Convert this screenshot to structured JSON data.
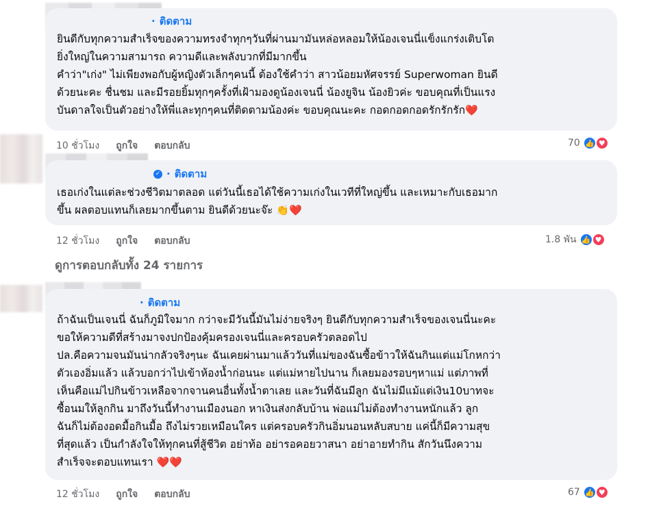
{
  "comments": [
    {
      "follow_label": "ติดตาม",
      "text": "ยินดีกับทุกความสำเร็จของความทรงจำทุกๆวันที่ผ่านมามันหล่อหลอมให้น้องเจนนี่แข็งแกร่งเติบโต\nยิ่งใหญ่ในความสามารถ ความดีและพลังบวกที่มีมากขึ้น\nคำว่า\"เก่ง\" ไม่เพียงพอกับผู้หญิงตัวเล็กๆคนนี้ ต้องใช้คำว่า สาวน้อยมหัศจรรย์ Superwoman ยินดี\nด้วยนะคะ ชื่นชม และมีรอยยิ้มทุกๆครั้งที่เฝ้ามองดูน้องเจนนี่ น้องยูจิน น้องยิวค่ะ ขอบคุณที่เป็นแรง\nบันดาลใจเป็นตัวอย่างให้พี่และทุกๆคนที่ติดตามน้องค่ะ ขอบคุณนะคะ กอดกอดกอดรักรักรัก",
      "end_emoji": "❤️",
      "time": "10 ชั่วโมง",
      "like_label": "ถูกใจ",
      "reply_label": "ตอบกลับ",
      "reaction_count": "70"
    },
    {
      "follow_label": "ติดตาม",
      "text": "เธอเก่งในแต่ละช่วงชีวิตมาตลอด แต่วันนี้เธอได้ใช้ความเก่งในเวทีที่ใหญ่ขึ้น และเหมาะกับเธอมาก\nขึ้น ผลตอบแทนก็เลยมากขึ้นตาม ยินดีด้วยนะจ๊ะ",
      "end_emoji": "👏❤️",
      "time": "12 ชั่วโมง",
      "like_label": "ถูกใจ",
      "reply_label": "ตอบกลับ",
      "reaction_count": "1.8 พัน"
    },
    {
      "follow_label": "ติดตาม",
      "text": "ถ้าฉันเป็นเจนนี่ ฉันก็ภูมิใจมาก กว่าจะมีวันนี้มันไม่ง่ายจริงๆ ยินดีกับทุกความสำเร็จของเจนนี่นะคะ\nขอให้ความดีที่สร้างมาจงปกป้องคุ้มครองเจนนี่และครอบครัวตลอดไป\nปล.คือความจนมันน่ากลัวจริงๆนะ ฉันเคยผ่านมาแล้ววันที่แม่ของฉันซื้อข้าวให้ฉันกินแต่แม่โกหกว่า\nตัวเองอิ่มแล้ว แล้วบอกว่าไปเข้าห้องน้ำก่อนนะ แต่แม่หายไปนาน ก็เลยมองรอบๆหาแม่ แต่ภาพที่\nเห็นคือแม่ไปกินข้าวเหลือจากจานคนอื่นทั้งน้ำตาเลย และวันที่ฉันมีลูก ฉันไม่มีแม้แต่เงิน10บาทจะ\nซื้อนมให้ลูกกิน มาถึงวันนี้ทำงานเมืองนอก หาเงินส่งกลับบ้าน พ่อแม่ไม่ต้องทำงานหนักแล้ว ลูก\nฉันก็ไม่ต้องอดมื้อกินมื้อ ถึงไม่รวยเหมือนใคร แต่ครอบครัวกินอิ่มนอนหลับสบาย แค่นี้ก็มีความสุข\nที่สุดแล้ว เป็นกำลังใจให้ทุกคนที่สู้ชีวิต อย่าท้อ อย่ารอคอยวาสนา อย่าอายทำกิน สักวันนึงความ\nสำเร็จจะตอบแทนเรา",
      "end_emoji": "❤️❤️",
      "time": "12 ชั่วโมง",
      "like_label": "ถูกใจ",
      "reply_label": "ตอบกลับ",
      "reaction_count": "67"
    }
  ],
  "view_replies": "ดูการตอบกลับทั้ง 24 รายการ",
  "icons": {
    "like": "like-reaction-icon",
    "love": "love-reaction-icon",
    "verified": "verified-badge-icon"
  },
  "colors": {
    "bubble": "#f0f2f5",
    "link": "#1877f2",
    "secondary": "#65676b",
    "love": "#f33e58"
  }
}
